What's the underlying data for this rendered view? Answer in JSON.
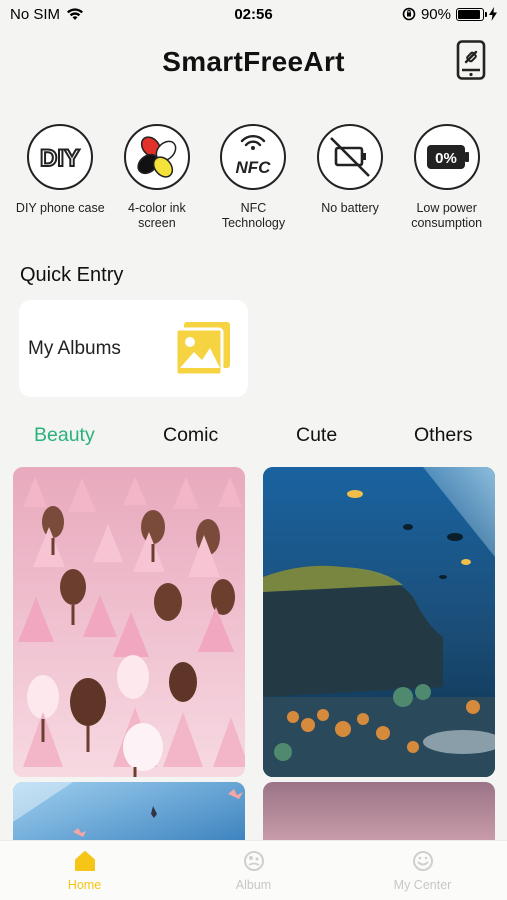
{
  "status_bar": {
    "carrier": "No SIM",
    "time": "02:56",
    "battery_percent": "90%",
    "battery_level": 0.9
  },
  "header": {
    "title": "SmartFreeArt",
    "device_icon": "phone-device-icon"
  },
  "features": [
    {
      "label": "DIY phone case",
      "icon": "diy-icon",
      "icon_text": "DIY"
    },
    {
      "label": "4-color ink screen",
      "icon": "four-color-ink-icon"
    },
    {
      "label": "NFC Technology",
      "icon": "nfc-icon",
      "icon_text": "NFC"
    },
    {
      "label": "No battery",
      "icon": "no-battery-icon"
    },
    {
      "label": "Low power consumption",
      "icon": "low-power-icon",
      "icon_text": "0%"
    }
  ],
  "quick_entry": {
    "title": "Quick Entry",
    "albums_label": "My Albums"
  },
  "tabs": [
    {
      "label": "Beauty",
      "active": true
    },
    {
      "label": "Comic",
      "active": false
    },
    {
      "label": "Cute",
      "active": false
    },
    {
      "label": "Others",
      "active": false
    }
  ],
  "bottom_nav": [
    {
      "label": "Home",
      "icon": "home-icon",
      "active": true
    },
    {
      "label": "Album",
      "icon": "album-icon",
      "active": false
    },
    {
      "label": "My Center",
      "icon": "my-center-icon",
      "active": false
    }
  ],
  "colors": {
    "accent_green": "#2bb27a",
    "accent_yellow": "#f5c518",
    "background": "#f4f4f2"
  }
}
